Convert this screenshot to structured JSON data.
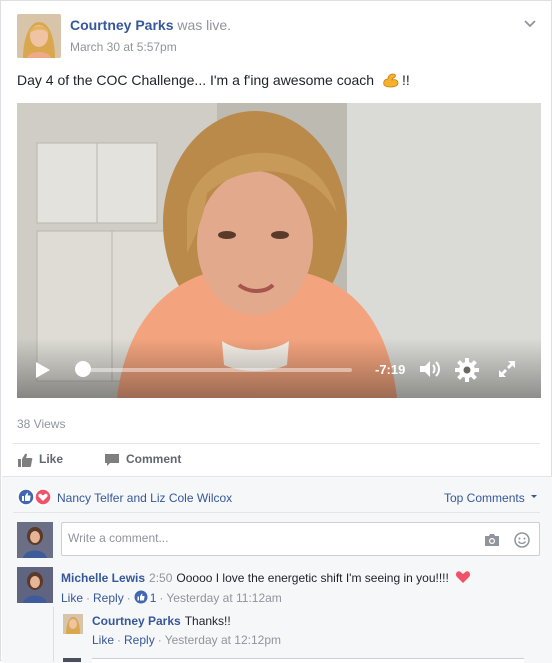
{
  "post": {
    "author": "Courtney Parks",
    "activity": " was live.",
    "date": "March 30 at 5:57pm",
    "text": "Day 4 of the COC Challenge... I'm a f'ing awesome coach",
    "text_suffix": "!!",
    "emoji_icon": "flexed-biceps-icon"
  },
  "video": {
    "time_remaining": "-7:19",
    "progress": 0.0
  },
  "views": "38 Views",
  "actions": {
    "like": "Like",
    "comment": "Comment"
  },
  "reactions": {
    "names": "Nancy Telfer and Liz Cole Wilcox",
    "sort_label": "Top Comments",
    "icons": [
      "like-icon",
      "love-icon"
    ]
  },
  "composer": {
    "placeholder": "Write a comment..."
  },
  "comments": [
    {
      "author": "Michelle Lewis",
      "timestamp": "2:50",
      "text": "Ooooo I love the energetic shift I'm seeing in you!!!!",
      "like": "Like",
      "reply": "Reply",
      "like_count": "1",
      "time": "Yesterday at 11:12am"
    },
    {
      "author": "Courtney Parks",
      "text": "Thanks!!",
      "like": "Like",
      "reply": "Reply",
      "time": "Yesterday at 12:12pm"
    }
  ],
  "colors": {
    "link": "#365899",
    "meta": "#90949c",
    "like_blue": "#4267b2",
    "love_red": "#f25268"
  }
}
